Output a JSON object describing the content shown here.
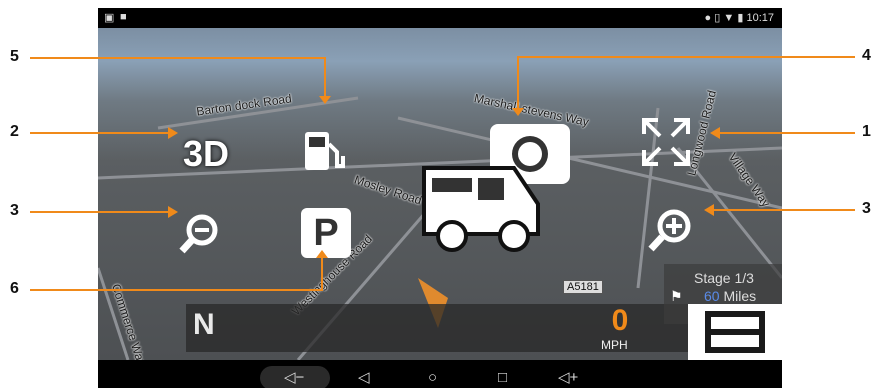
{
  "status_bar": {
    "left_icons": [
      "notification-icon",
      "lock-icon"
    ],
    "right_icons": [
      "location-icon",
      "vibrate-icon",
      "wifi-icon",
      "battery-icon"
    ],
    "time": "10:17"
  },
  "map": {
    "roads": [
      {
        "name": "Barton dock Road"
      },
      {
        "name": "Marshall stevens Way"
      },
      {
        "name": "Longwood Road"
      },
      {
        "name": "Village Way"
      },
      {
        "name": "Mosley Road"
      },
      {
        "name": "Westinghouse Road"
      },
      {
        "name": "Commerce Way"
      }
    ],
    "road_badge": "A5181"
  },
  "overlay_buttons": {
    "view_3d_label": "3D",
    "parking_label": "P"
  },
  "bottom_panel": {
    "compass": "N",
    "speed_value": "0",
    "speed_unit": "MPH",
    "stage": "Stage 1/3",
    "distance_value": "60",
    "distance_unit": "Miles"
  },
  "annotations": {
    "labels": [
      "5",
      "2",
      "3",
      "6",
      "4",
      "1",
      "3"
    ]
  },
  "colors": {
    "annotation_line": "#f08a1a",
    "speed_text": "#f08a1a",
    "distance_text": "#5a8be8"
  },
  "nav_bar": {
    "buttons": [
      "volume-down-icon",
      "back-icon",
      "home-icon",
      "recents-icon",
      "volume-up-icon"
    ]
  }
}
